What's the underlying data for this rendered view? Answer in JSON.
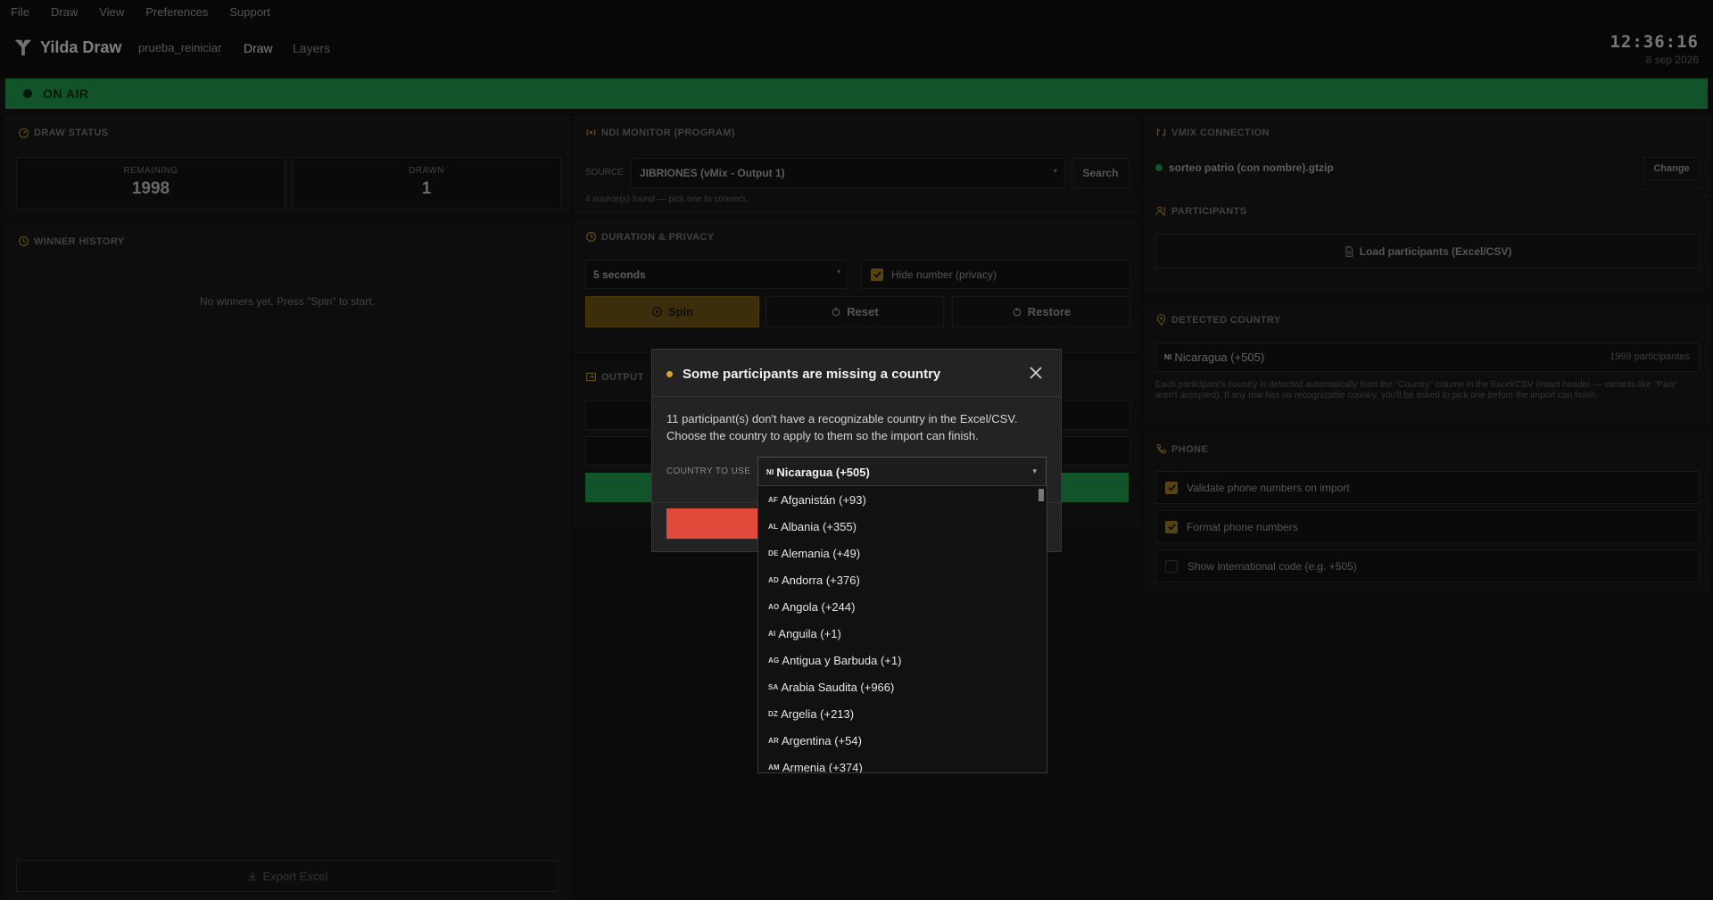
{
  "menu": [
    "File",
    "Draw",
    "View",
    "Preferences",
    "Support"
  ],
  "app": {
    "brand": "Yilda Draw",
    "project": "prueba_reiniciar",
    "nav_draw": "Draw",
    "nav_layers": "Layers"
  },
  "clock": {
    "time": "12:36:16",
    "date": "8 sep 2026"
  },
  "onair": {
    "label": "ON AIR",
    "color": "#1f9a4b"
  },
  "draw_status": {
    "title": "DRAW STATUS",
    "remaining_label": "REMAINING",
    "remaining_value": "1998",
    "drawn_label": "DRAWN",
    "drawn_value": "1"
  },
  "winner_history": {
    "title": "WINNER HISTORY",
    "empty": "No winners yet. Press \"Spin\" to start.",
    "export_label": "Export Excel"
  },
  "ndi": {
    "title": "NDI MONITOR (PROGRAM)",
    "source_label": "SOURCE",
    "source_value": "JIBRIONES (vMix - Output 1)",
    "search_label": "Search",
    "hint": "4 source(s) found — pick one to connect."
  },
  "duration": {
    "title": "DURATION & PRIVACY",
    "seconds_value": "5 seconds",
    "hide_label": "Hide number (privacy)",
    "spin_label": "Spin",
    "reset_label": "Reset",
    "restore_label": "Restore"
  },
  "output": {
    "title": "OUTPUT"
  },
  "vmix": {
    "title": "VMIX CONNECTION",
    "file": "sorteo patrio (con nombre).gtzip",
    "change_label": "Change",
    "status_color": "#1f9a4b"
  },
  "participants": {
    "title": "PARTICIPANTS",
    "load_label": "Load participants (Excel/CSV)"
  },
  "detected_country": {
    "title": "DETECTED COUNTRY",
    "code": "NI",
    "value": "Nicaragua (+505)",
    "count": "1999 participantes",
    "note": "Each participant's country is detected automatically from the \"Country\" column in the Excel/CSV (exact header — variants like \"País\" aren't accepted). If any row has no recognizable country, you'll be asked to pick one before the import can finish."
  },
  "phone": {
    "title": "PHONE",
    "opt1": "Validate phone numbers on import",
    "opt2": "Format phone numbers",
    "opt3": "Show international code (e.g. +505)"
  },
  "modal": {
    "title": "Some participants are missing a country",
    "desc_line1": "11 participant(s) don't have a recognizable country in the Excel/CSV.",
    "desc_line2": "Choose the country to apply to them so the import can finish.",
    "country_label": "COUNTRY TO USE",
    "selected_code": "NI",
    "selected_value": "Nicaragua (+505)",
    "accent": "#e0a526",
    "confirm_color": "#e14a3b"
  },
  "countries": [
    {
      "code": "AF",
      "name": "Afganistán (+93)"
    },
    {
      "code": "AL",
      "name": "Albania (+355)"
    },
    {
      "code": "DE",
      "name": "Alemania (+49)"
    },
    {
      "code": "AD",
      "name": "Andorra (+376)"
    },
    {
      "code": "AO",
      "name": "Angola (+244)"
    },
    {
      "code": "AI",
      "name": "Anguila (+1)"
    },
    {
      "code": "AG",
      "name": "Antigua y Barbuda (+1)"
    },
    {
      "code": "SA",
      "name": "Arabia Saudita (+966)"
    },
    {
      "code": "DZ",
      "name": "Argelia (+213)"
    },
    {
      "code": "AR",
      "name": "Argentina (+54)"
    },
    {
      "code": "AM",
      "name": "Armenia (+374)"
    }
  ]
}
